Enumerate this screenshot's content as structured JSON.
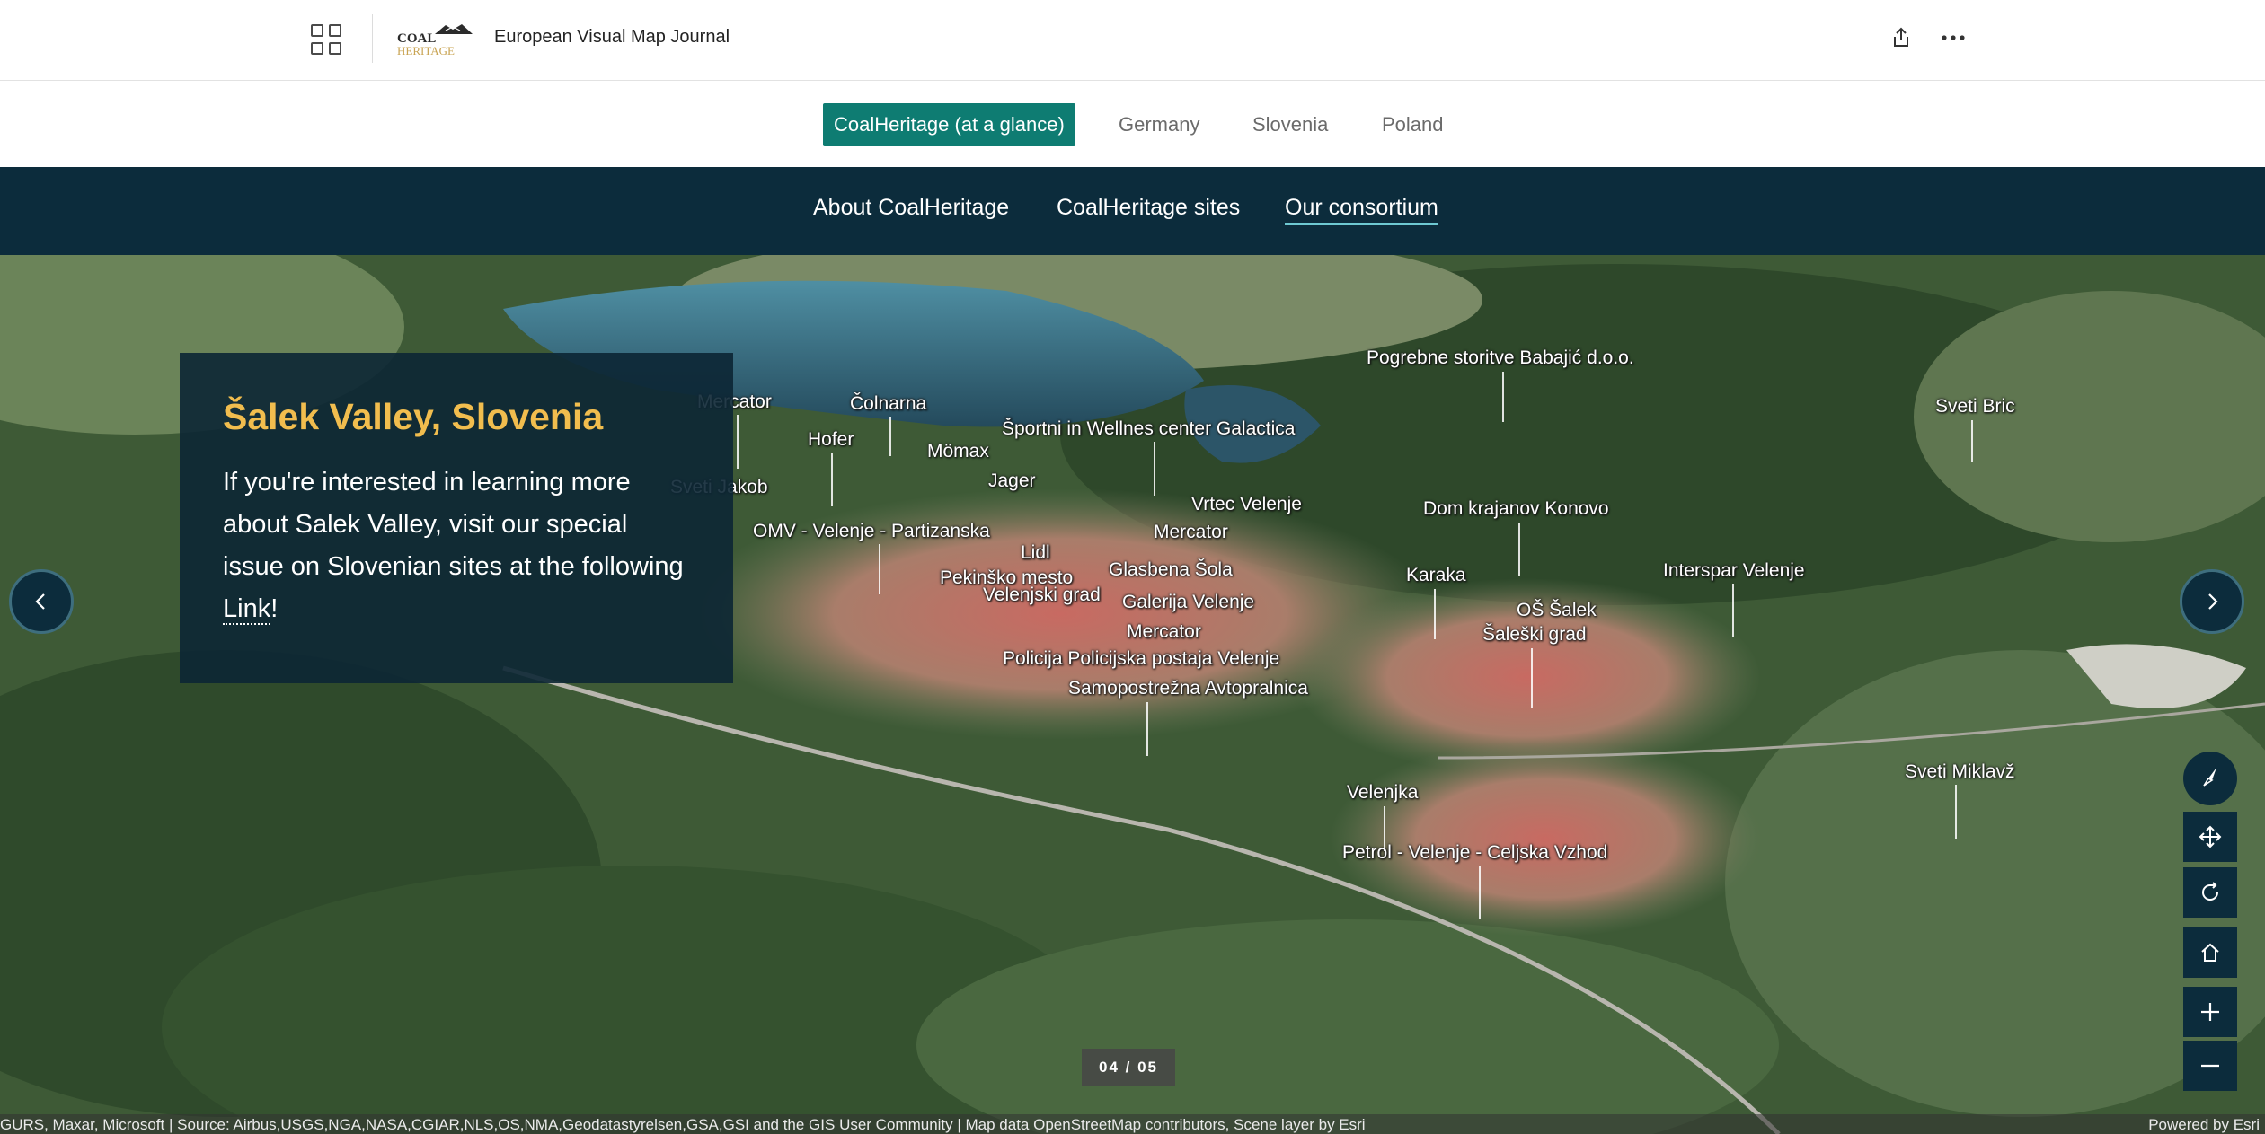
{
  "header": {
    "story_title": "European Visual Map Journal",
    "logo_text_top": "COAL",
    "logo_text_bottom": "HERITAGE",
    "share_icon": "share-icon",
    "more_icon": "more-icon"
  },
  "topnav": {
    "items": [
      {
        "label": "CoalHeritage (at a glance)",
        "active": true
      },
      {
        "label": "Germany",
        "active": false
      },
      {
        "label": "Slovenia",
        "active": false
      },
      {
        "label": "Poland",
        "active": false
      }
    ]
  },
  "subnav": {
    "items": [
      {
        "label": "About CoalHeritage"
      },
      {
        "label": "CoalHeritage sites"
      },
      {
        "label": "Our consortium",
        "current": true
      }
    ]
  },
  "info": {
    "title": "Šalek Valley, Slovenia",
    "body_before_link": "If you're interested in learning more about  Salek Valley, visit our special issue on Slovenian sites at the following ",
    "link_text": "Link",
    "body_after_link": "!"
  },
  "map": {
    "poi_labels": [
      "Mercator",
      "Čolnarna",
      "Hofer",
      "Mömax",
      "Športni in Wellnes center Galactica",
      "Pogrebne storitve Babajić d.o.o.",
      "Sveti Bric",
      "Sveti Jakob",
      "Jager",
      "OMV - Velenje - Partizanska",
      "Vrtec Velenje",
      "Dom krajanov Konovo",
      "Mercator",
      "Lidl",
      "Glasbena Šola",
      "Pekinško mesto",
      "Velenjski grad",
      "Karaka",
      "Interspar Velenje",
      "Galerija Velenje",
      "OŠ Šalek",
      "Mercator",
      "Šaleški grad",
      "Policija Policijska postaja Velenje",
      "Samopostrežna Avtopralnica",
      "Sveti Miklavž",
      "Velenjka",
      "Petrol - Velenje - Celjska Vzhod"
    ],
    "counter": "04  /  05",
    "attribution": "GURS, Maxar, Microsoft | Source: Airbus,USGS,NGA,NASA,CGIAR,NLS,OS,NMA,Geodatastyrelsen,GSA,GSI and the GIS User Community | Map data OpenStreetMap contributors, Scene layer by Esri",
    "powered_by": "Powered by Esri"
  },
  "colors": {
    "primary_nav_active": "#0e7c72",
    "subnav_bg": "#0c2c3c",
    "title_accent": "#f1bd4e",
    "subnav_underline": "#6ec9d2"
  },
  "icons": {
    "apps": "grid-icon",
    "prev": "chevron-left-icon",
    "next": "chevron-right-icon",
    "compass": "compass-icon",
    "pan": "pan-icon",
    "rotate": "rotate-icon",
    "home": "home-icon",
    "zoom_in": "plus-icon",
    "zoom_out": "minus-icon"
  }
}
